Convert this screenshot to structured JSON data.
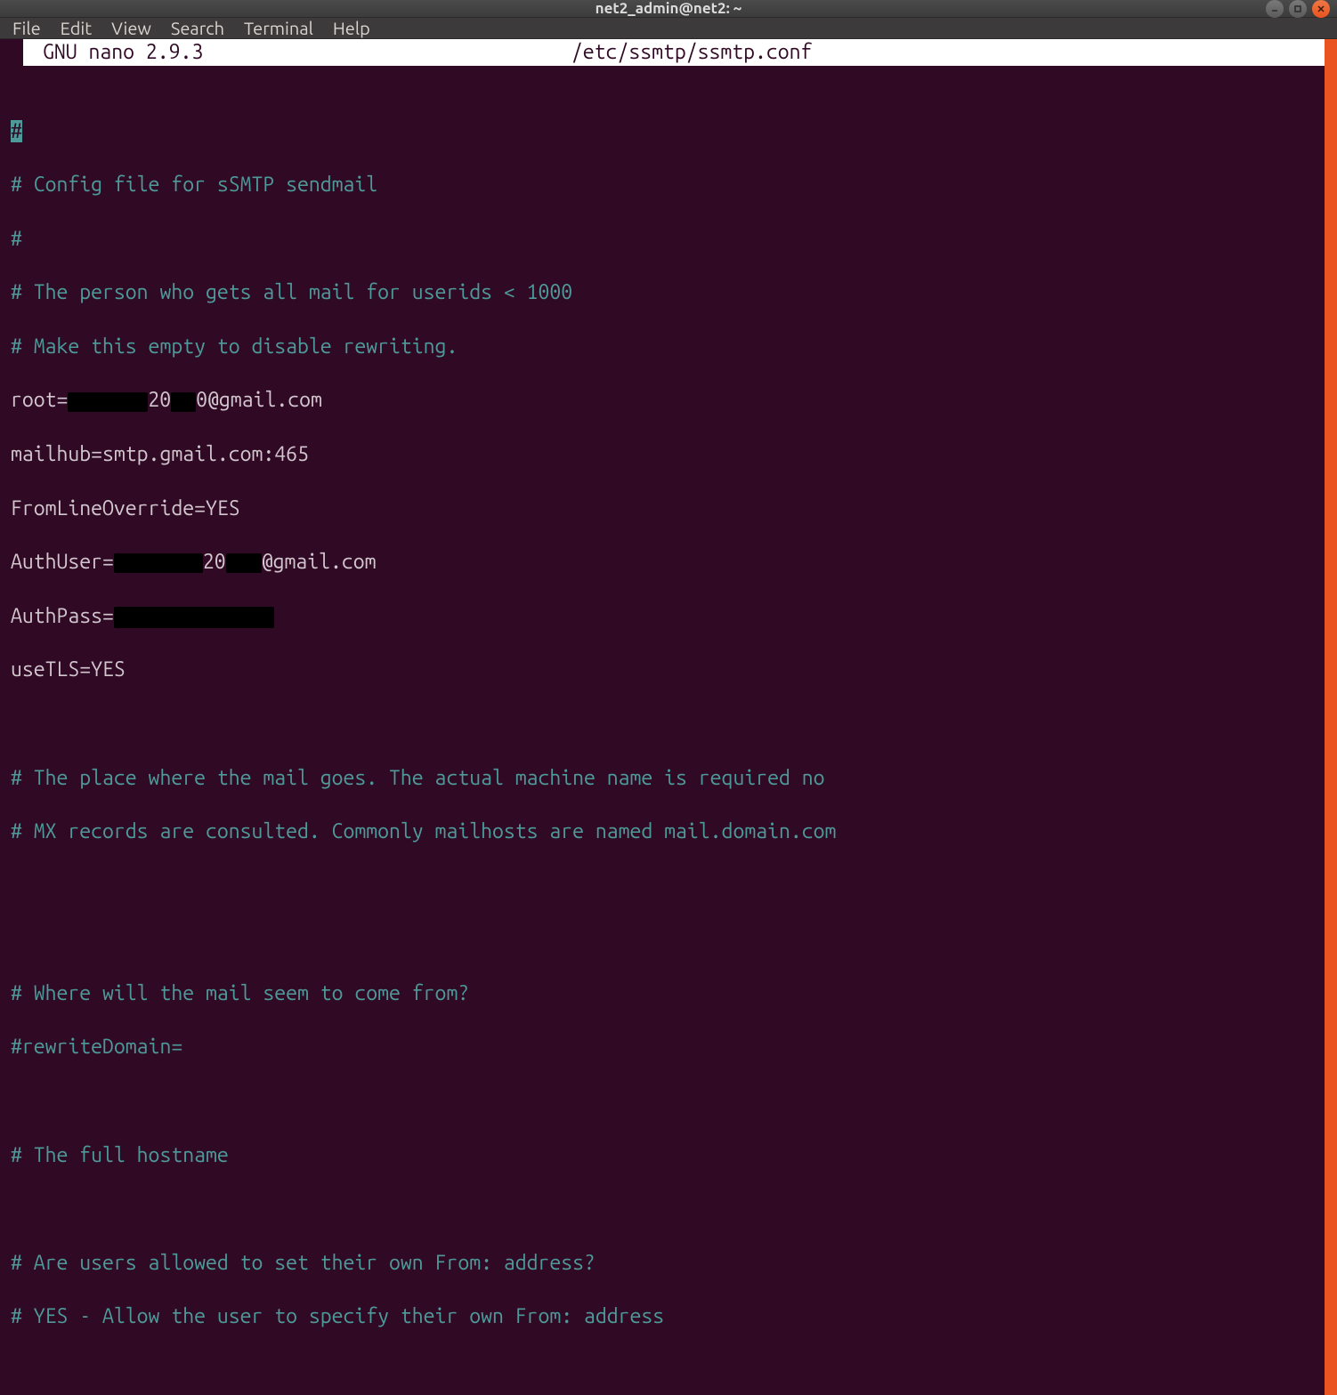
{
  "window": {
    "title": "net2_admin@net2: ~"
  },
  "menubar": {
    "file": "File",
    "edit": "Edit",
    "view": "View",
    "search": "Search",
    "terminal": "Terminal",
    "help": "Help"
  },
  "nano": {
    "version": "GNU nano 2.9.3",
    "filename": "/etc/ssmtp/ssmtp.conf"
  },
  "content": {
    "l1": "#",
    "l2": "# Config file for sSMTP sendmail",
    "l3": "#",
    "l4": "# The person who gets all mail for userids < 1000",
    "l5": "# Make this empty to disable rewriting.",
    "l6a": "root=",
    "l6b": "20",
    "l6c": "0@gmail.com",
    "l7": "mailhub=smtp.gmail.com:465",
    "l8": "FromLineOverride=YES",
    "l9a": "AuthUser=",
    "l9b": "20",
    "l9c": "@gmail.com",
    "l10": "AuthPass=",
    "l11": "useTLS=YES",
    "l12": "# The place where the mail goes. The actual machine name is required no",
    "l13": "# MX records are consulted. Commonly mailhosts are named mail.domain.com",
    "l14": "# Where will the mail seem to come from?",
    "l15": "#rewriteDomain=",
    "l16": "# The full hostname",
    "l17": "# Are users allowed to set their own From: address?",
    "l18": "# YES - Allow the user to specify their own From: address"
  }
}
